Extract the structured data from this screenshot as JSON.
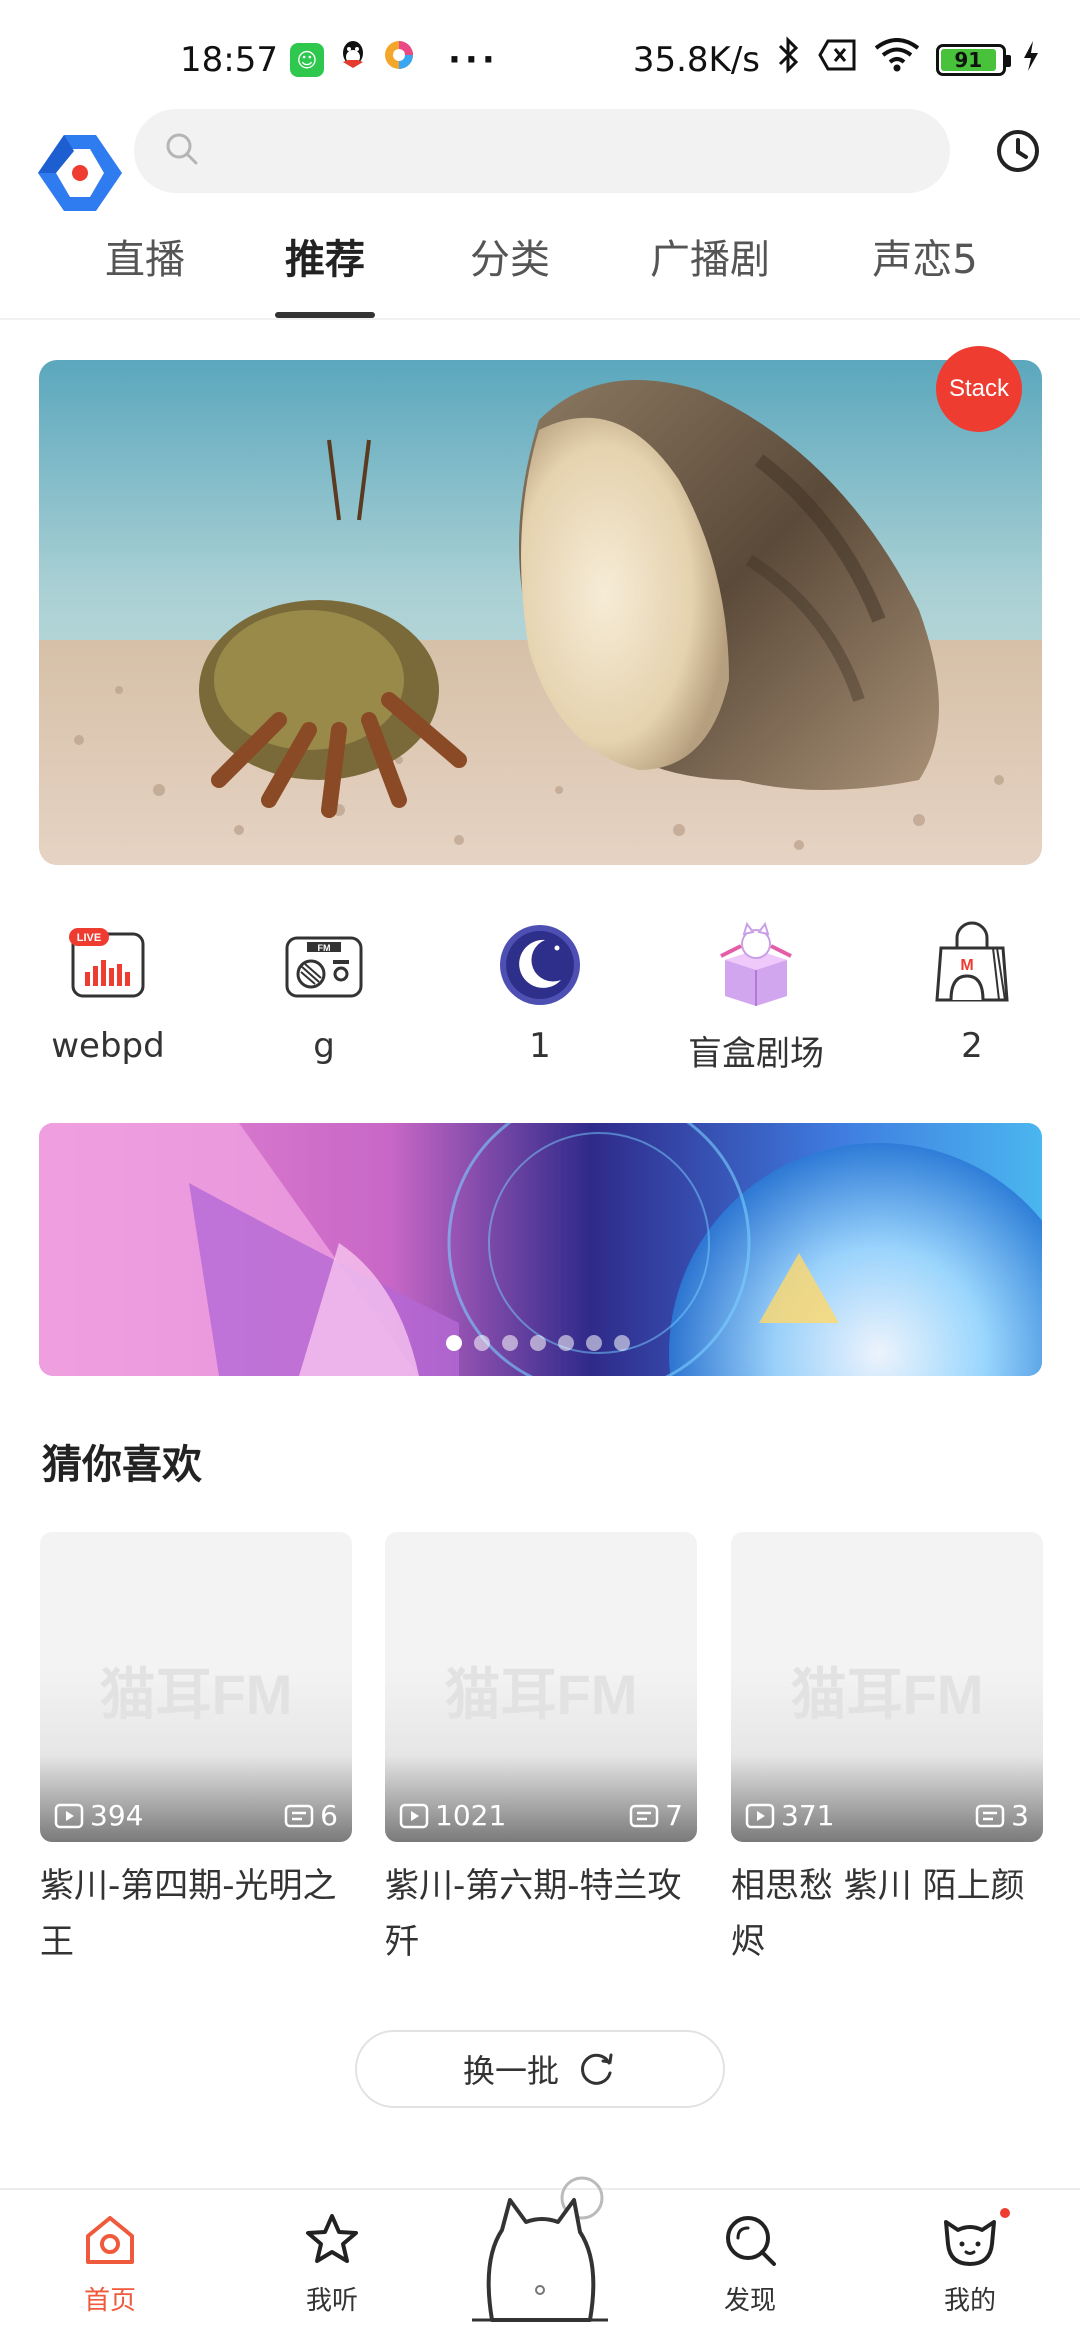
{
  "status_bar": {
    "time": "18:57",
    "net_speed": "35.8K/s",
    "battery": "91",
    "more": "···"
  },
  "header": {
    "search_placeholder": "",
    "icons": [
      "app-logo-icon",
      "search-icon",
      "history-clock-icon"
    ]
  },
  "tabs": [
    {
      "label": "直播",
      "active": false
    },
    {
      "label": "推荐",
      "active": true
    },
    {
      "label": "分类",
      "active": false
    },
    {
      "label": "广播剧",
      "active": false
    },
    {
      "label": "声恋5",
      "active": false
    }
  ],
  "banner": {
    "badge": "Stack"
  },
  "entries": [
    {
      "label": "webpd",
      "icon": "live-icon"
    },
    {
      "label": "g",
      "icon": "radio-fm-icon"
    },
    {
      "label": "1",
      "icon": "moon-icon"
    },
    {
      "label": "盲盒剧场",
      "icon": "blind-box-icon"
    },
    {
      "label": "2",
      "icon": "shopping-bag-icon"
    }
  ],
  "section": {
    "title": "猜你喜欢"
  },
  "cards": [
    {
      "watermark": "猫耳FM",
      "plays": "394",
      "episodes": "6",
      "title": "紫川-第四期-光明之王"
    },
    {
      "watermark": "猫耳FM",
      "plays": "1021",
      "episodes": "7",
      "title": "紫川-第六期-特兰攻歼"
    },
    {
      "watermark": "猫耳FM",
      "plays": "371",
      "episodes": "3",
      "title": "相思愁 紫川 陌上颜烬"
    }
  ],
  "refresh": {
    "label": "换一批"
  },
  "bottom_nav": [
    {
      "label": "首页",
      "active": true
    },
    {
      "label": "我听",
      "active": false
    },
    {
      "label": "发现",
      "active": false
    },
    {
      "label": "我的",
      "active": false
    }
  ],
  "colors": {
    "accent": "#ef5a3c",
    "badge_red": "#ef3c31",
    "logo_blue": "#2f7bf0"
  }
}
